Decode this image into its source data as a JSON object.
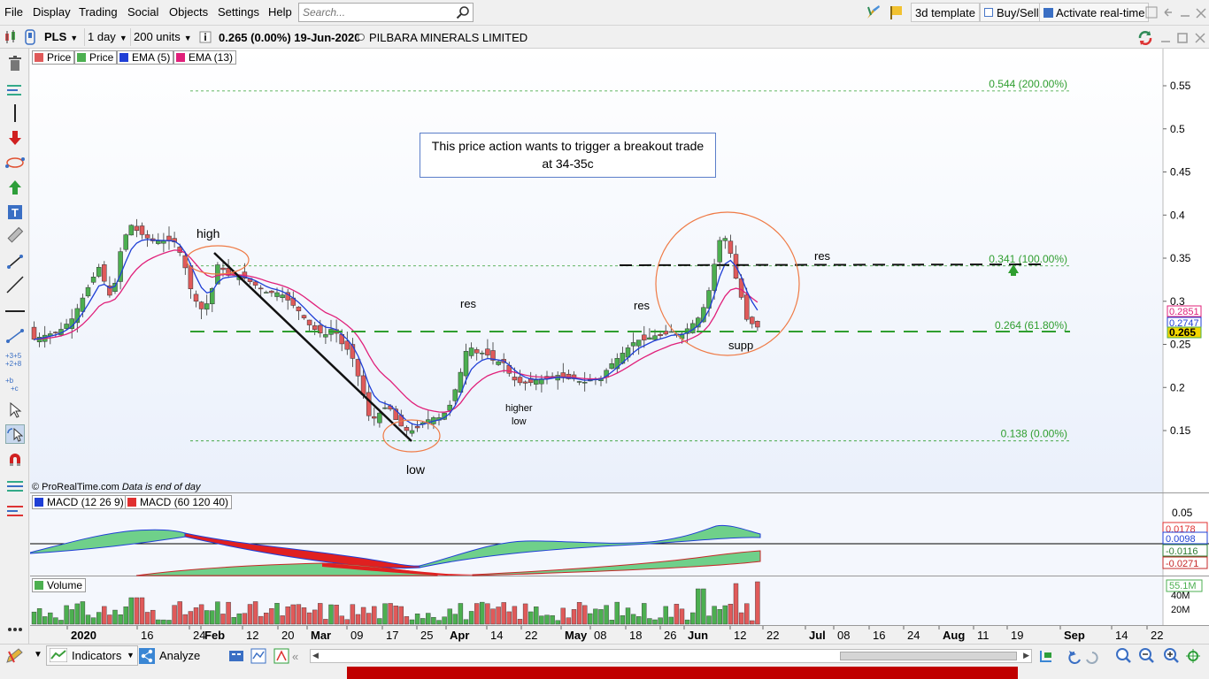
{
  "menu": [
    "File",
    "Display",
    "Trading",
    "Social",
    "Objects",
    "Settings",
    "Help"
  ],
  "search": {
    "placeholder": "Search..."
  },
  "topbar": {
    "template_label": "3d template",
    "buysell_label": "Buy/Sell",
    "realtime_label": "Activate real-time"
  },
  "instrument": {
    "ticker": "PLS",
    "timeframe": "1 day",
    "units": "200 units",
    "quote": "0.265 (0.00%) 19-Jun-2020",
    "name": "PILBARA MINERALS LIMITED"
  },
  "legend_price": [
    {
      "label": "Price",
      "color": "#e05a5a"
    },
    {
      "label": "Price",
      "color": "#4caf50"
    },
    {
      "label": "EMA (5)",
      "color": "#1f3fd6"
    },
    {
      "label": "EMA (13)",
      "color": "#e0207a"
    }
  ],
  "legend_macd": [
    {
      "label": "MACD (12 26 9)",
      "color": "#1f3fd6"
    },
    {
      "label": "MACD (60 120 40)",
      "color": "#e03030"
    }
  ],
  "legend_volume": {
    "label": "Volume",
    "color": "#4caf50"
  },
  "copyright": "© ProRealTime.com",
  "data_note": "Data is end of day",
  "annotation_box": {
    "line1": "This price action wants to trigger a breakout trade",
    "line2": "at  34-35c"
  },
  "labels": {
    "high": "high",
    "low": "low",
    "res1": "res",
    "res2": "res",
    "res3": "res",
    "supp": "supp",
    "higher_low": "higher\nlow"
  },
  "fib": [
    {
      "value": 0.544,
      "label": "0.544 (200.00%)"
    },
    {
      "value": 0.341,
      "label": "0.341 (100.00%)"
    },
    {
      "value": 0.264,
      "label": "0.264 (61.80%)"
    },
    {
      "value": 0.138,
      "label": "0.138 (0.00%)"
    }
  ],
  "price_axis": {
    "ticks": [
      "0.55",
      "0.5",
      "0.45",
      "0.4",
      "0.35",
      "0.3",
      "0.25",
      "0.2",
      "0.15"
    ],
    "tags": [
      {
        "text": "0.2851",
        "color": "#e0207a"
      },
      {
        "text": "0.2747",
        "color": "#1f3fd6"
      },
      {
        "text": "0.265",
        "color": "#4caf50"
      }
    ]
  },
  "macd_axis": {
    "ticks": [
      "0.05"
    ],
    "tags": [
      {
        "text": "0.0178",
        "color": "#e03030"
      },
      {
        "text": "0.0098",
        "color": "#1f3fd6"
      },
      {
        "text": "-0.0116",
        "color": "#2e7d32"
      },
      {
        "text": "-0.0271",
        "color": "#c62828"
      }
    ]
  },
  "volume_axis": {
    "ticks": [
      "40M",
      "20M"
    ],
    "tag": {
      "text": "55.1M",
      "color": "#4caf50"
    }
  },
  "date_axis": [
    {
      "text": "2020",
      "bold": true
    },
    {
      "text": "16"
    },
    {
      "text": "24"
    },
    {
      "text": "Feb",
      "bold": true
    },
    {
      "text": "12"
    },
    {
      "text": "20"
    },
    {
      "text": "Mar",
      "bold": true
    },
    {
      "text": "09"
    },
    {
      "text": "17"
    },
    {
      "text": "25"
    },
    {
      "text": "Apr",
      "bold": true
    },
    {
      "text": "14"
    },
    {
      "text": "22"
    },
    {
      "text": "May",
      "bold": true
    },
    {
      "text": "08"
    },
    {
      "text": "18"
    },
    {
      "text": "26"
    },
    {
      "text": "Jun",
      "bold": true
    },
    {
      "text": "12"
    },
    {
      "text": "22"
    },
    {
      "text": "Jul",
      "bold": true
    },
    {
      "text": "08"
    },
    {
      "text": "16"
    },
    {
      "text": "24"
    },
    {
      "text": "Aug",
      "bold": true
    },
    {
      "text": "11"
    },
    {
      "text": "19"
    },
    {
      "text": "Sep",
      "bold": true
    },
    {
      "text": "14"
    },
    {
      "text": "22"
    }
  ],
  "bottom": {
    "indicators_label": "Indicators",
    "analyze_label": "Analyze"
  },
  "colors": {
    "up": "#4caf50",
    "down": "#e05a5a",
    "ema5": "#1f3fd6",
    "ema13": "#e0207a",
    "fib": "#2f9e2f",
    "circle": "#ef7a45"
  }
}
